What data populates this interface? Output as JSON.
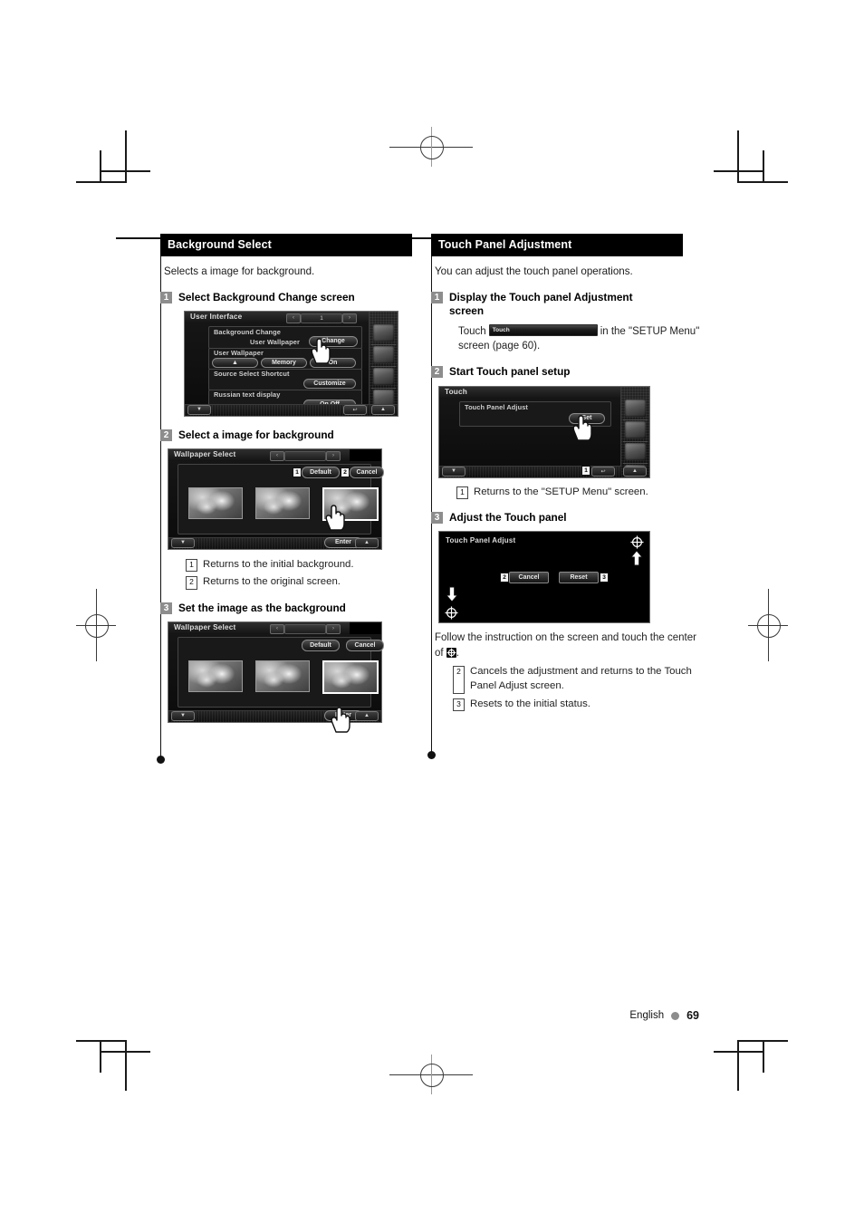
{
  "document": {
    "footer": {
      "language": "English",
      "page_number": "69"
    }
  },
  "left_column": {
    "section_title": "Background Select",
    "intro": "Selects a image for background.",
    "steps": [
      {
        "num": "1",
        "title": "Select Background Change screen",
        "device": {
          "title": "User Interface",
          "page_indicator": "1",
          "prev_arrow": "‹",
          "next_arrow": "›",
          "rows": [
            {
              "label": "Background Change",
              "value": "User Wallpaper",
              "button": "Change"
            },
            {
              "label": "User Wallpaper",
              "buttons": [
                "▲",
                "Memory",
                "On"
              ]
            },
            {
              "label": "Source Select Shortcut",
              "button": "Customize"
            },
            {
              "label": "Russian text display",
              "button": "On  Off"
            }
          ],
          "bottom_left": "▼",
          "bottom_right_return": "↩",
          "bottom_corner": "▲"
        }
      },
      {
        "num": "2",
        "title": "Select a image for background",
        "device": {
          "title": "Wallpaper Select",
          "prev_arrow": "‹",
          "next_arrow": "›",
          "buttons": [
            {
              "tag": "1",
              "label": "Default"
            },
            {
              "tag": "2",
              "label": "Cancel"
            }
          ],
          "enter_button": "Enter",
          "thumbnail_count": 3,
          "selected_thumbnail": 3
        },
        "callouts": [
          {
            "tag": "1",
            "text": "Returns to the initial background."
          },
          {
            "tag": "2",
            "text": "Returns to the original screen."
          }
        ]
      },
      {
        "num": "3",
        "title": "Set the image as the background",
        "device": {
          "title": "Wallpaper Select",
          "prev_arrow": "‹",
          "next_arrow": "›",
          "buttons": [
            {
              "tag": "",
              "label": "Default"
            },
            {
              "tag": "",
              "label": "Cancel"
            }
          ],
          "enter_button": "Enter",
          "thumbnail_count": 3,
          "selected_thumbnail": 3
        }
      }
    ]
  },
  "right_column": {
    "section_title": "Touch Panel Adjustment",
    "intro": "You can adjust the touch panel operations.",
    "steps": [
      {
        "num": "1",
        "title": "Display the Touch panel Adjustment screen",
        "body_before": "Touch",
        "inline_button_label": "Touch",
        "body_after": "in the \"SETUP Menu\" screen (page 60)."
      },
      {
        "num": "2",
        "title": "Start Touch panel setup",
        "device": {
          "title": "Touch",
          "panel_label": "Touch Panel Adjust",
          "set_button": "Set",
          "bottom_left": "▼",
          "return_tag": "1",
          "return_icon": "↩",
          "bottom_corner": "▲"
        },
        "callouts": [
          {
            "tag": "1",
            "text": "Returns to the \"SETUP Menu\" screen."
          }
        ]
      },
      {
        "num": "3",
        "title": "Adjust the Touch panel",
        "device": {
          "title": "Touch Panel Adjust",
          "cancel_tag": "2",
          "cancel_button": "Cancel",
          "reset_button": "Reset",
          "reset_tag": "3"
        },
        "body_text_1": "Follow the instruction on the screen and touch the center of",
        "body_text_2": ".",
        "callouts": [
          {
            "tag": "2",
            "text": "Cancels the adjustment and returns to the Touch Panel Adjust screen."
          },
          {
            "tag": "3",
            "text": "Resets to the initial status."
          }
        ]
      }
    ]
  }
}
